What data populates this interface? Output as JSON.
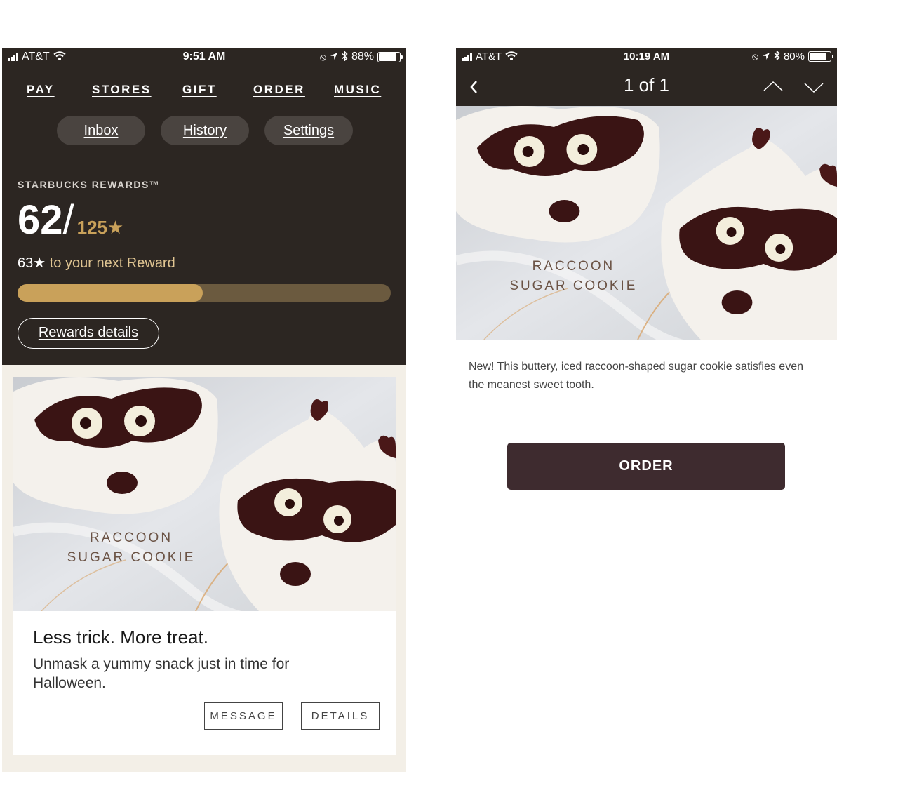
{
  "left_screen": {
    "status_bar": {
      "carrier": "AT&T",
      "time": "9:51 AM",
      "battery": "88%",
      "battery_level": 0.88
    },
    "nav": [
      "PAY",
      "STORES",
      "GIFT",
      "ORDER",
      "MUSIC"
    ],
    "pills": [
      "Inbox",
      "History",
      "Settings"
    ],
    "rewards": {
      "label": "STARBUCKS REWARDS™",
      "current_stars": "62",
      "slash": "/",
      "goal": "125★",
      "remaining": "63★",
      "remaining_text": " to your next Reward",
      "progress_fraction": 0.496,
      "details_button": "Rewards details"
    },
    "card": {
      "image_caption_line1": "RACCOON",
      "image_caption_line2": "SUGAR COOKIE",
      "title": "Less trick. More treat.",
      "text": "Unmask a yummy snack just in time for Halloween.",
      "message_button": "MESSAGE",
      "details_button": "DETAILS"
    }
  },
  "right_screen": {
    "status_bar": {
      "carrier": "AT&T",
      "time": "10:19 AM",
      "battery": "80%",
      "battery_level": 0.8
    },
    "pager": "1 of 1",
    "image_caption_line1": "RACCOON",
    "image_caption_line2": "SUGAR COOKIE",
    "description": "New! This buttery, iced raccoon-shaped sugar cookie satisfies even the meanest sweet tooth.",
    "order_button": "ORDER"
  },
  "colors": {
    "dark_brown": "#2c2622",
    "gold": "#c9a15a",
    "order_button": "#3e2b2f",
    "cream": "#f3efe7"
  }
}
